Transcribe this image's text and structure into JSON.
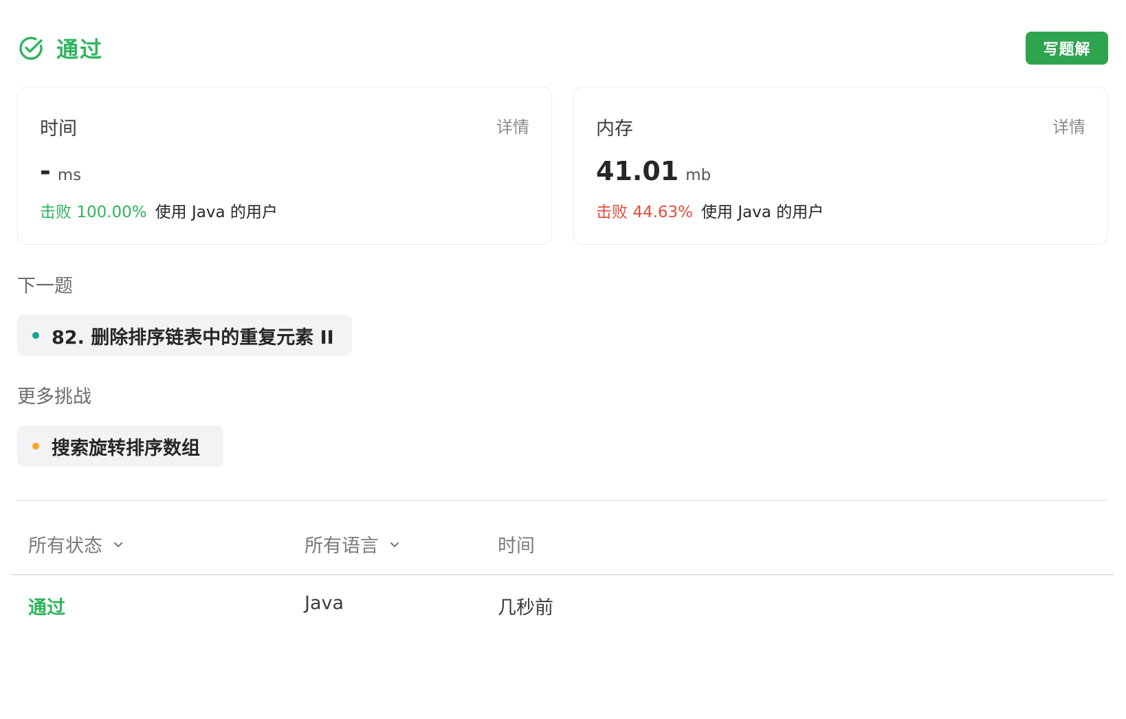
{
  "header": {
    "status_label": "通过",
    "status_icon": "check-circle-icon",
    "solution_button_label": "写题解"
  },
  "time_card": {
    "title": "时间",
    "detail_link": "详情",
    "value": "-",
    "unit": "ms",
    "beat_prefix": "击败",
    "beat_percent": "100.00%",
    "beat_suffix": "使用 Java 的用户"
  },
  "memory_card": {
    "title": "内存",
    "detail_link": "详情",
    "value": "41.01",
    "unit": "mb",
    "beat_prefix": "击败",
    "beat_percent": "44.63%",
    "beat_suffix": "使用 Java 的用户"
  },
  "next_problem": {
    "label": "下一题",
    "item": "82. 删除排序链表中的重复元素 II"
  },
  "more_challenges": {
    "label": "更多挑战",
    "item": "搜索旋转排序数组"
  },
  "submissions": {
    "headers": {
      "status": "所有状态",
      "language": "所有语言",
      "time": "时间"
    },
    "rows": [
      {
        "status": "通过",
        "language": "Java",
        "time": "几秒前"
      }
    ]
  },
  "colors": {
    "accepted_green": "#2db55d",
    "button_green": "#2ea44f",
    "beat_red": "#e94a3a",
    "dot_teal": "#1aa38f",
    "dot_orange": "#f5a623"
  }
}
